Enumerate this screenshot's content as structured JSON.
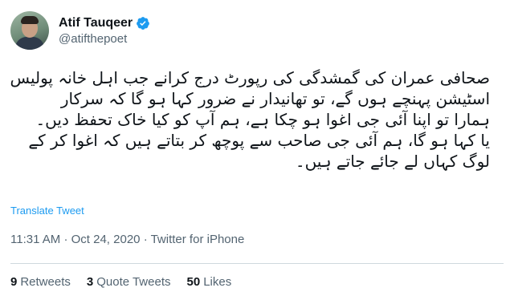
{
  "author": {
    "display_name": "Atif Tauqeer",
    "handle": "@atifthepoet",
    "verified": true
  },
  "tweet": {
    "lines": [
      "صحافی عمران کی گمشدگی کی رپورٹ درج کرانے جب اہل خانہ پولیس",
      "اسٹیشن پہنچے ہوں گے، تو تھانیدار نے ضرور کہا ہو گا کہ سرکار",
      "ہمارا تو اپنا آئی جی اغوا ہو چکا ہے، ہم آپ کو کیا خاک تحفظ دیں۔",
      "یا کہا ہو گا، ہم آئی جی صاحب سے پوچھ کر بتاتے ہیں کہ اغوا کر کے",
      "لوگ کہاں لے جائے جاتے ہیں۔"
    ],
    "translate_label": "Translate Tweet",
    "time": "11:31 AM",
    "separator": "·",
    "date": "Oct 24, 2020",
    "source": "Twitter for iPhone"
  },
  "stats": {
    "retweets_count": "9",
    "retweets_label": "Retweets",
    "quotes_count": "3",
    "quotes_label": "Quote Tweets",
    "likes_count": "50",
    "likes_label": "Likes"
  },
  "colors": {
    "link": "#1d9bf0",
    "secondary_text": "#536471",
    "verified_badge": "#1d9bf0"
  },
  "icons": {
    "verified": "verified-badge-icon"
  }
}
